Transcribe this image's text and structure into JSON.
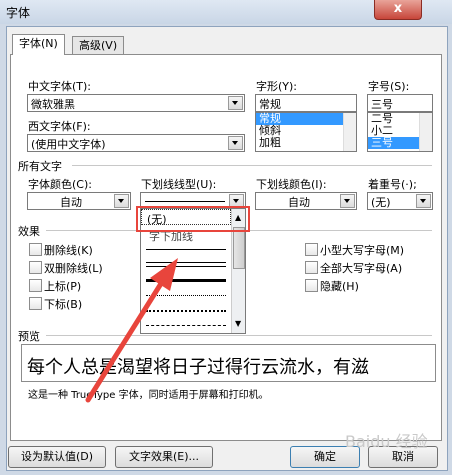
{
  "window": {
    "title": "字体",
    "close_symbol": "x"
  },
  "tabs": [
    {
      "label": "字体(N)"
    },
    {
      "label": "高级(V)"
    }
  ],
  "chinese_font": {
    "label": "中文字体(T):",
    "value": "微软雅黑"
  },
  "western_font": {
    "label": "西文字体(F):",
    "value": "(使用中文字体)"
  },
  "font_style": {
    "label": "字形(Y):",
    "value": "常规",
    "options": [
      "常规",
      "倾斜",
      "加粗"
    ],
    "selected": "常规"
  },
  "font_size": {
    "label": "字号(S):",
    "value": "三号",
    "options": [
      "二号",
      "小二",
      "三号"
    ],
    "selected": "三号"
  },
  "all_text": {
    "section_label": "所有文字",
    "font_color": {
      "label": "字体颜色(C):",
      "value": "自动"
    },
    "underline_style": {
      "label": "下划线线型(U):"
    },
    "underline_color": {
      "label": "下划线颜色(I):",
      "value": "自动"
    },
    "emphasis": {
      "label": "着重号(·);",
      "value": "(无)"
    }
  },
  "underline_dropdown": {
    "items": [
      "(无)",
      "字下加线"
    ]
  },
  "effects": {
    "section_label": "效果",
    "left": [
      "删除线(K)",
      "双删除线(L)",
      "上标(P)",
      "下标(B)"
    ],
    "right": [
      "小型大写字母(M)",
      "全部大写字母(A)",
      "隐藏(H)"
    ]
  },
  "preview": {
    "section_label": "预览",
    "sample": "每个人总是渴望将日子过得行云流水，有滋",
    "note": "这是一种 TrueType 字体，同时适用于屏幕和打印机。"
  },
  "buttons": {
    "set_default": "设为默认值(D)",
    "text_effects": "文字效果(E)...",
    "ok": "确定",
    "cancel": "取消"
  },
  "watermark": "Baidu 经验",
  "colors": {
    "highlight": "#3399ff",
    "annotation_red": "#e8453c"
  }
}
